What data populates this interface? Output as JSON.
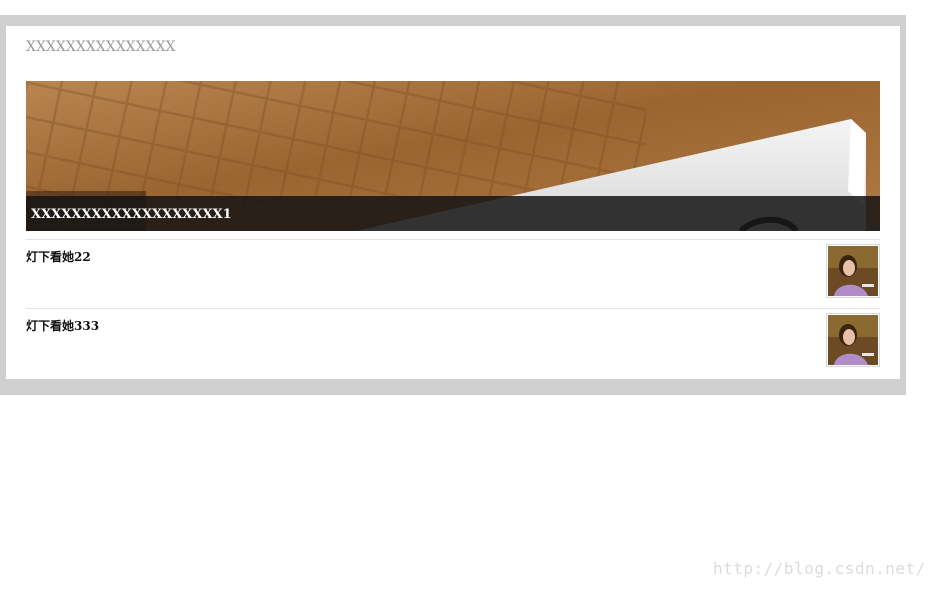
{
  "card": {
    "title": "XXXXXXXXXXXXXXX"
  },
  "hero": {
    "caption": "XXXXXXXXXXXXXXXXXXX1",
    "image_icon": "photo-image"
  },
  "news": [
    {
      "title": "灯下看她22",
      "thumb_icon": "portrait-thumbnail"
    },
    {
      "title": "灯下看她333",
      "thumb_icon": "portrait-thumbnail"
    }
  ],
  "watermark": "http://blog.csdn.net/",
  "colors": {
    "frame": "#cfcfcf",
    "caption_bar": "#141414",
    "title_gray": "#9a9a9a"
  }
}
